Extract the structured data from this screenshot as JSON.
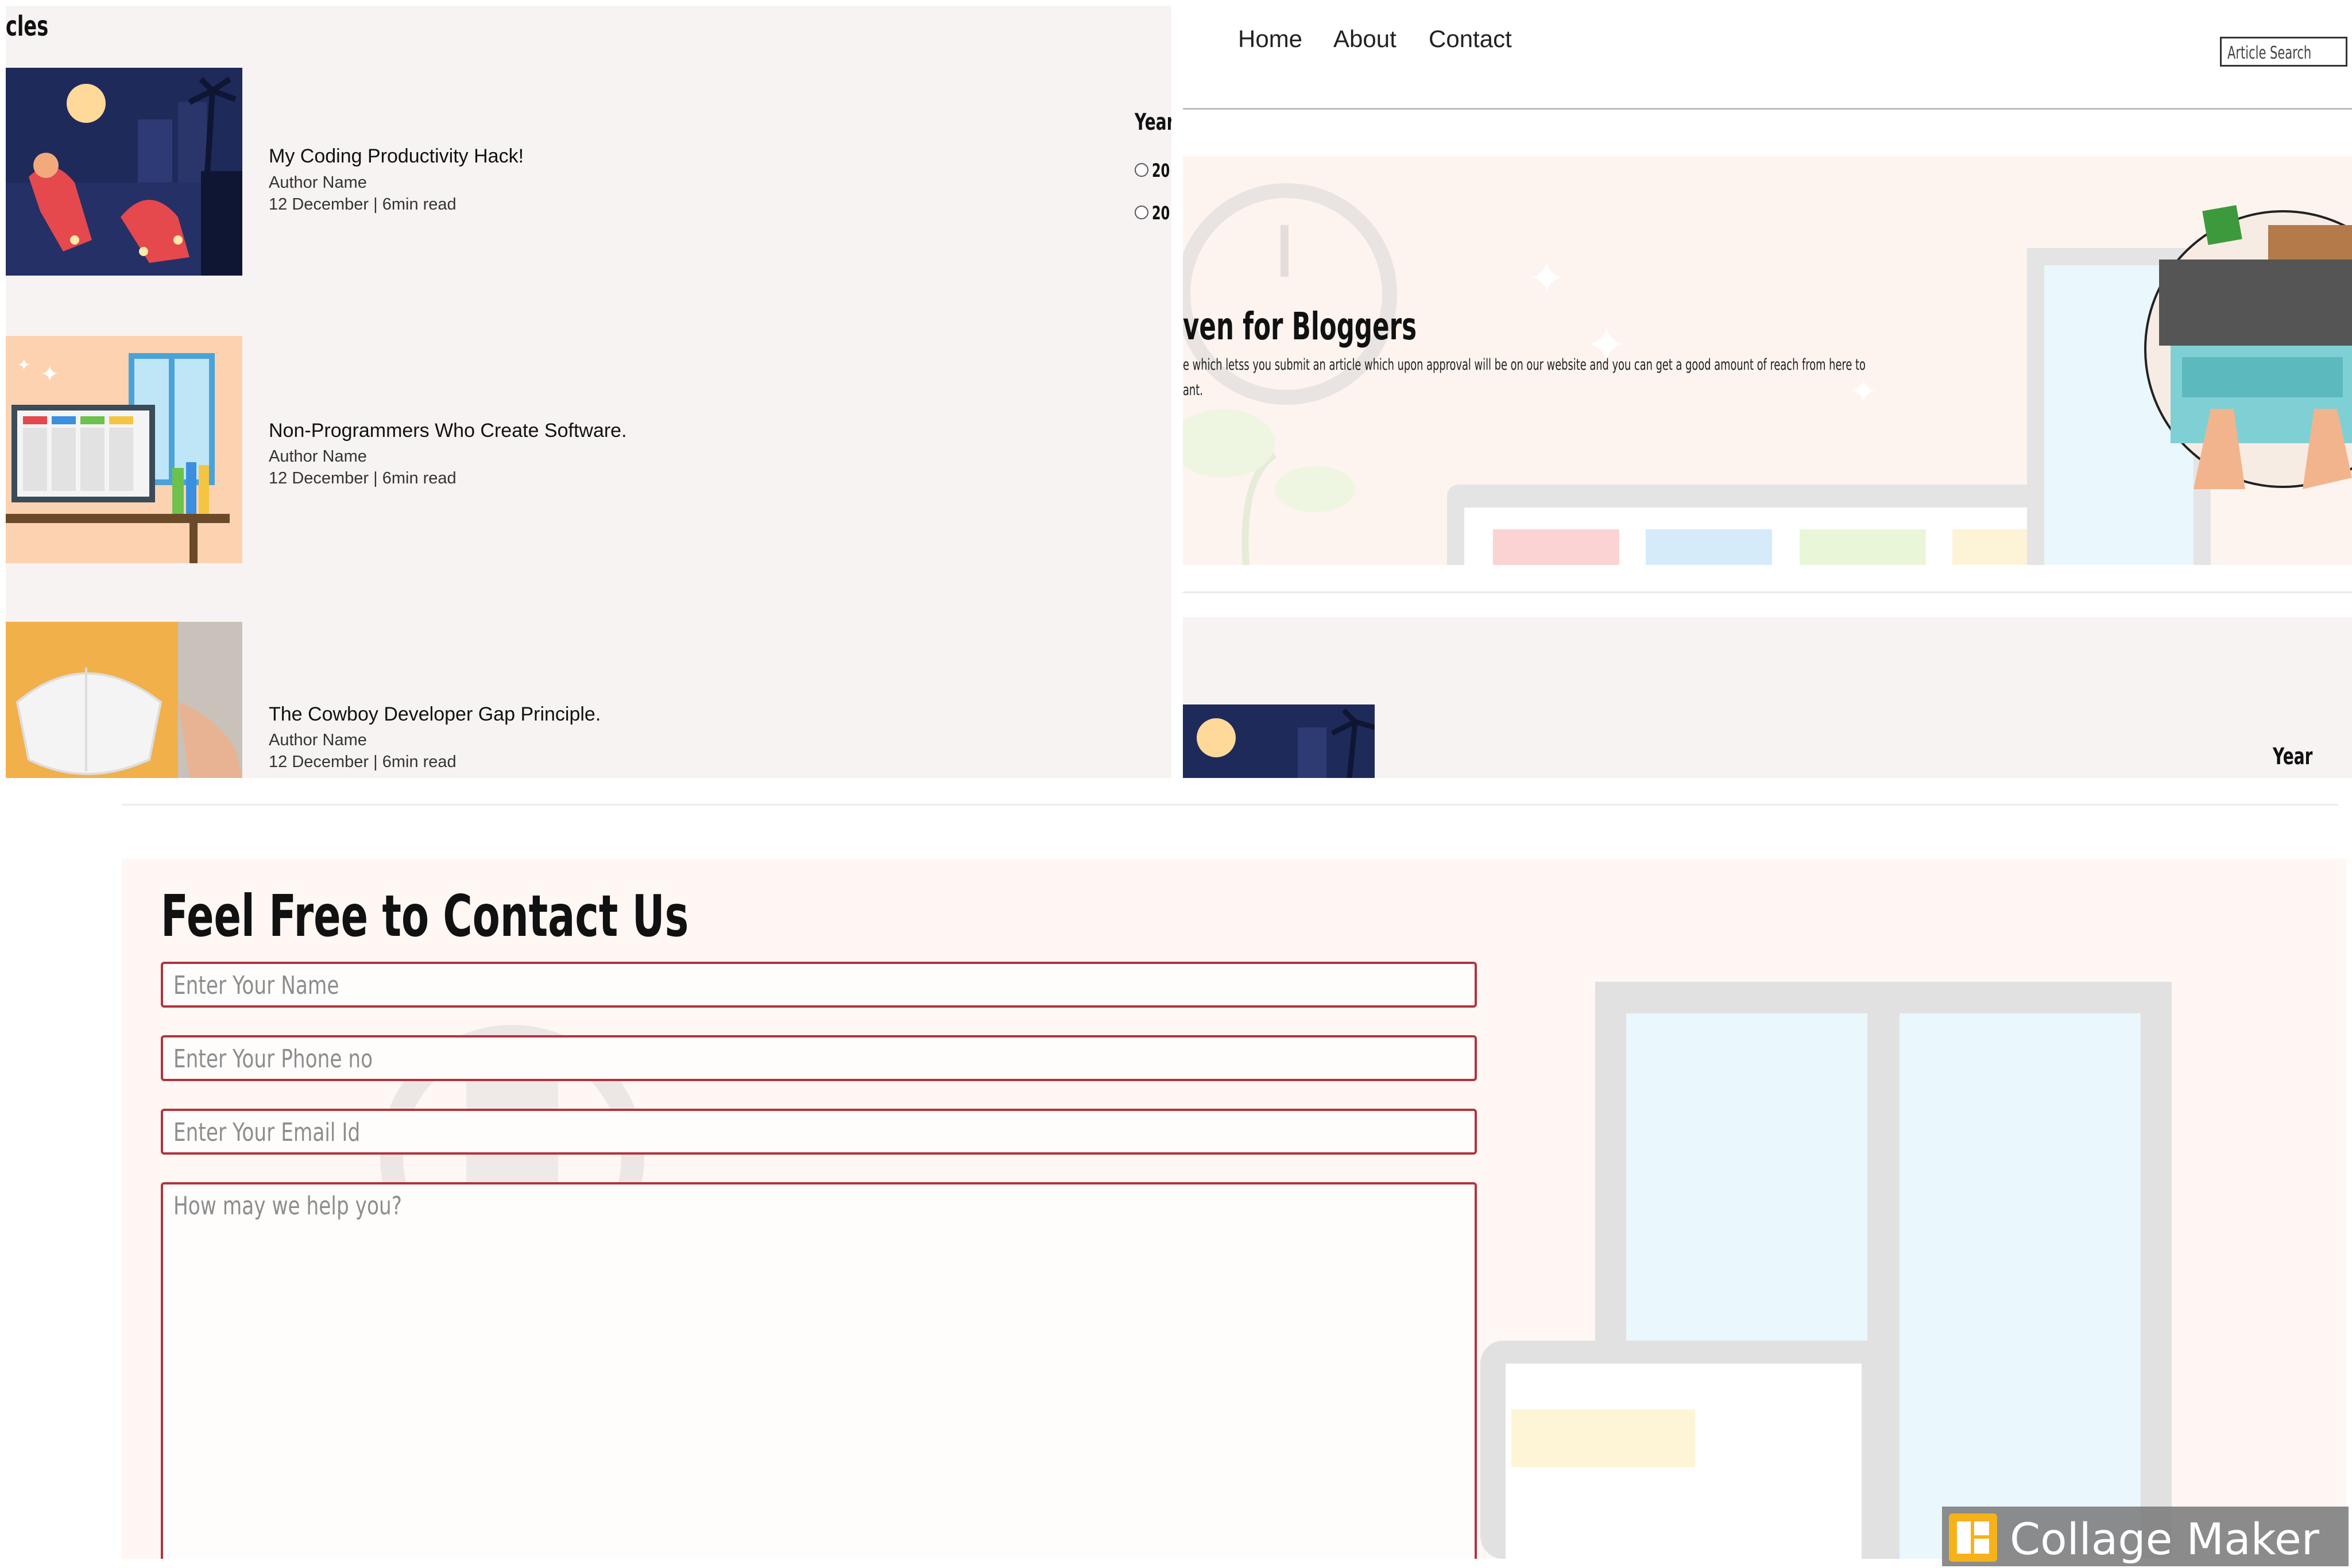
{
  "left_panel": {
    "heading_fragment": "cles",
    "year_label": "Year",
    "year_options": [
      "20",
      "20"
    ],
    "articles": [
      {
        "title": "My Coding Productivity Hack!",
        "author": "Author Name",
        "meta": "12 December | 6min read"
      },
      {
        "title": "Non-Programmers Who Create Software.",
        "author": "Author Name",
        "meta": "12 December | 6min read"
      },
      {
        "title": "The Cowboy Developer Gap Principle.",
        "author": "Author Name",
        "meta": "12 December | 6min read"
      }
    ]
  },
  "right_panel": {
    "nav": {
      "home": "Home",
      "about": "About",
      "contact": "Contact"
    },
    "search_placeholder": "Article Search",
    "hero": {
      "title_fragment": "ven for Bloggers",
      "text_line1": "e which letss you submit an article which upon approval will be on our website and you can get a good amount of reach from here to",
      "text_line2": "ant."
    },
    "year_label": "Year"
  },
  "contact": {
    "heading": "Feel Free to Contact Us",
    "name_placeholder": "Enter Your Name",
    "phone_placeholder": "Enter Your Phone no",
    "email_placeholder": "Enter Your Email Id",
    "message_placeholder": "How may we help you?"
  },
  "watermark": {
    "label": "Collage Maker",
    "icon": "collage-grid-icon"
  },
  "colors": {
    "accent_border": "#b5323c",
    "panel_bg": "#f8f3f3",
    "hero_bg": "#fdf4f0",
    "dark_illustration": "#1e2a5a"
  }
}
